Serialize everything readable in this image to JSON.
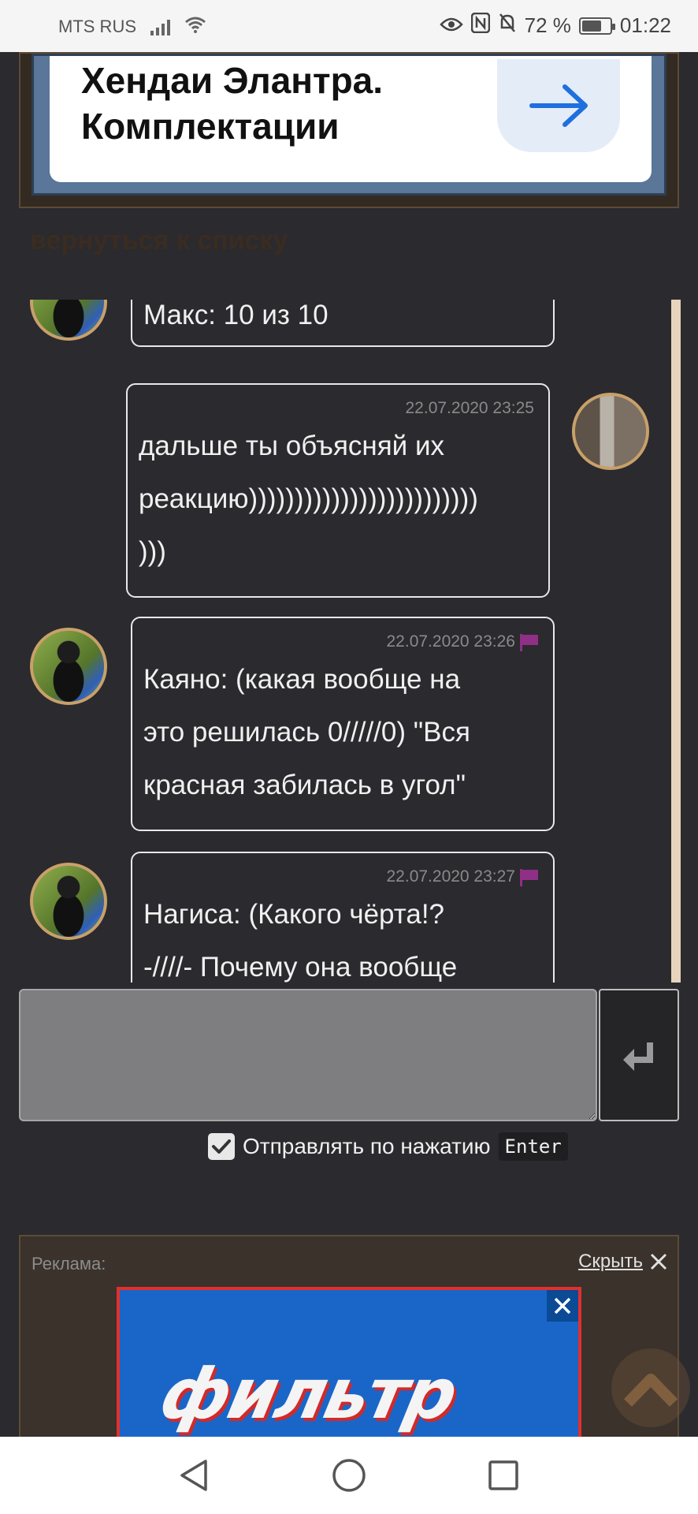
{
  "status_bar": {
    "carrier": "MTS RUS",
    "battery_percent": "72 %",
    "battery_level": 0.72,
    "time": "01:22"
  },
  "top_ad": {
    "headline": "Хендаи Элантра. Комплектации"
  },
  "back_link": "вернуться к списку",
  "messages": [
    {
      "text": "Макс: 10 из 10",
      "timestamp": ""
    },
    {
      "text_lines": [
        "дальше ты объясняй их",
        "реакцию)))))))))))))))))))))))))",
        ")))"
      ],
      "timestamp": "22.07.2020 23:25"
    },
    {
      "text_lines": [
        "Каяно: (какая вообще на",
        "это решилась 0/////0) \"Вся",
        "красная забилась в угол\""
      ],
      "timestamp": "22.07.2020 23:26"
    },
    {
      "text_lines": [
        "Нагиса: (Какого чёрта!?",
        "-////-  Почему она вообще"
      ],
      "timestamp": "22.07.2020 23:27"
    }
  ],
  "composer": {
    "placeholder": "",
    "send_on_enter_checked": true,
    "send_on_enter_label": "Отправлять по нажатию",
    "enter_key": "Enter"
  },
  "bottom_ad": {
    "label": "Реклама:",
    "hide": "Скрыть",
    "logo": "фильтр"
  },
  "icons": {
    "arrow": "arrow-right-icon",
    "send": "enter-return-icon",
    "flag": "flag-icon",
    "close": "close-icon",
    "scroll_top": "chevron-up-icon",
    "nav_back": "triangle-back-icon",
    "nav_home": "circle-home-icon",
    "nav_recent": "square-recents-icon"
  },
  "colors": {
    "background": "#2b2a2e",
    "avatar_border": "#c9a06a",
    "flag": "#8f2f86",
    "ad_blue": "#1966c8",
    "ad_red": "#e0302e"
  }
}
